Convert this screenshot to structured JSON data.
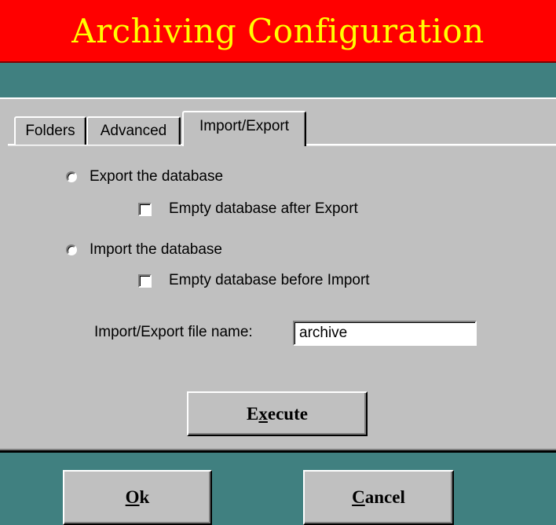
{
  "window": {
    "title": "Archiving Configuration"
  },
  "tabs": [
    {
      "label": "Folders",
      "active": false
    },
    {
      "label": "Advanced",
      "active": false
    },
    {
      "label": "Import/Export",
      "active": true
    }
  ],
  "options": {
    "export_label": "Export the database",
    "export_selected": false,
    "empty_after_export_label": "Empty database after Export",
    "empty_after_export_checked": false,
    "import_label": "Import the database",
    "import_selected": false,
    "empty_before_import_label": "Empty database before Import",
    "empty_before_import_checked": false
  },
  "file": {
    "label": "Import/Export file name:",
    "value": "archive"
  },
  "buttons": {
    "execute_pre": "E",
    "execute_key": "x",
    "execute_post": "ecute",
    "ok_key": "O",
    "ok_post": "k",
    "cancel_key": "C",
    "cancel_post": "ancel"
  },
  "colors": {
    "title_bg": "#ff0000",
    "title_text": "#ffff00",
    "background": "#408080",
    "panel": "#c0c0c0"
  }
}
